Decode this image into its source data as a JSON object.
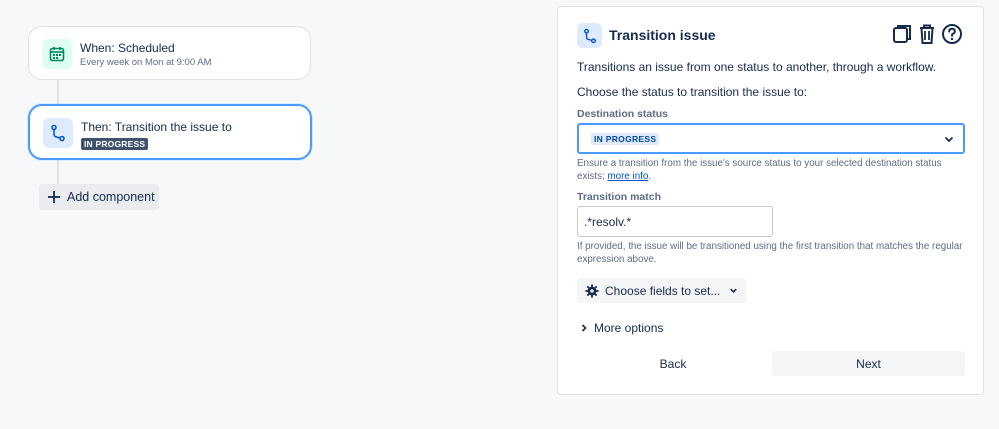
{
  "canvas": {
    "trigger": {
      "title": "When: Scheduled",
      "subtitle": "Every week on Mon at 9:00 AM",
      "icon": "calendar-icon"
    },
    "action": {
      "title": "Then: Transition the issue to",
      "status": "IN PROGRESS",
      "icon": "transition-icon"
    },
    "add_component_label": "Add component"
  },
  "panel": {
    "title": "Transition issue",
    "description": "Transitions an issue from one status to another, through a workflow.",
    "prompt": "Choose the status to transition the issue to:",
    "destination": {
      "label": "Destination status",
      "value": "IN PROGRESS",
      "help_prefix": "Ensure a transition from the issue's source status to your selected destination status exists;",
      "help_link": "more info",
      "help_suffix": "."
    },
    "match": {
      "label": "Transition match",
      "value": ".*resolv.*",
      "help": "If provided, the issue will be transitioned using the first transition that matches the regular expression above."
    },
    "choose_fields_label": "Choose fields to set...",
    "more_options_label": "More options",
    "back_label": "Back",
    "next_label": "Next"
  },
  "colors": {
    "accent_border": "#4c9aff",
    "lozenge_dark": "#42526e",
    "lozenge_blue_bg": "#deebff",
    "lozenge_blue_text": "#0747a6",
    "calendar_green": "#00875a"
  }
}
